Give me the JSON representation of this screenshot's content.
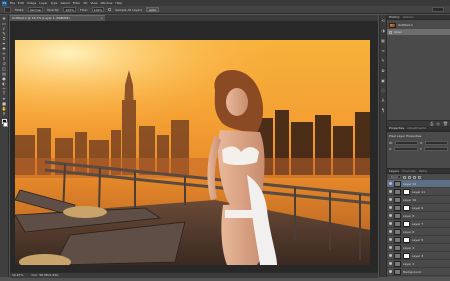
{
  "app": {
    "logo": "Ps",
    "menu": [
      "File",
      "Edit",
      "Image",
      "Layer",
      "Type",
      "Select",
      "Filter",
      "3D",
      "View",
      "Window",
      "Help"
    ]
  },
  "options_bar": {
    "mode_label": "Mode:",
    "mode_value": "Normal",
    "opacity_label": "Opacity:",
    "opacity_value": "100%",
    "flow_label": "Flow:",
    "flow_value": "100%",
    "sample_all_label": "Sample All Layers",
    "auto_button": "Auto"
  },
  "document": {
    "tab_title": "Untitled-1 @ 16.7% (Layer 1, RGB/8#)",
    "close_glyph": "×",
    "status_zoom": "16.67%",
    "status_doc": "Doc: 98.9M/1.63G"
  },
  "toolbar": {
    "tools": [
      "move-icon",
      "marquee-icon",
      "lasso-icon",
      "quick-select-icon",
      "crop-icon",
      "eyedropper-icon",
      "healing-icon",
      "brush-icon",
      "clone-stamp-icon",
      "history-brush-icon",
      "eraser-icon",
      "gradient-icon",
      "blur-icon",
      "dodge-icon",
      "pen-icon",
      "type-icon",
      "path-select-icon",
      "shape-icon",
      "hand-icon",
      "zoom-icon"
    ],
    "glyphs": [
      "✥",
      "▭",
      "ℓ",
      "✎",
      "⌗",
      "✒",
      "✚",
      "✏",
      "⚲",
      "↺",
      "◫",
      "▤",
      "●",
      "◐",
      "✑",
      "T",
      "➤",
      "■",
      "✋",
      "⚲"
    ]
  },
  "right_strip": {
    "icons": [
      "history-panel-icon",
      "adjust-icon",
      "layers-icon",
      "channels-icon",
      "paths-icon",
      "brush-panel-icon",
      "swatch-icon",
      "info-icon",
      "character-icon",
      "paragraph-icon"
    ],
    "glyphs": [
      "⟲",
      "◑",
      "▦",
      "≡",
      "✎",
      "✿",
      "▣",
      "ⓘ",
      "A",
      "¶"
    ]
  },
  "history_panel": {
    "tabs": [
      "History",
      "Actions"
    ],
    "rows": [
      {
        "label": "Untitled-1",
        "kind": "snapshot"
      },
      {
        "label": "Open",
        "kind": "step"
      }
    ],
    "footer_icons": [
      "⎙",
      "◎",
      "🗑"
    ]
  },
  "properties_panel": {
    "tabs": [
      "Properties",
      "Adjustments"
    ],
    "title": "Pixel Layer Properties",
    "fields": [
      "W:",
      "H:",
      "X:",
      "Y:"
    ]
  },
  "layers_panel": {
    "tabs": [
      "Layers",
      "Channels",
      "Paths"
    ],
    "kind_filter": "Kind",
    "rows": [
      "Layer 12",
      "Layer 11",
      "Layer 10",
      "Layer 9",
      "Layer 8",
      "Layer 7",
      "Layer 6",
      "Layer 5",
      "Layer 4",
      "Layer 3",
      "Layer 2",
      "Background"
    ]
  },
  "colors": {
    "accent": "#5c6f86",
    "panel_bg": "#4a4a4a",
    "canvas_bg": "#282828",
    "foreground_swatch": "#111111",
    "background_swatch": "#ffffff"
  }
}
